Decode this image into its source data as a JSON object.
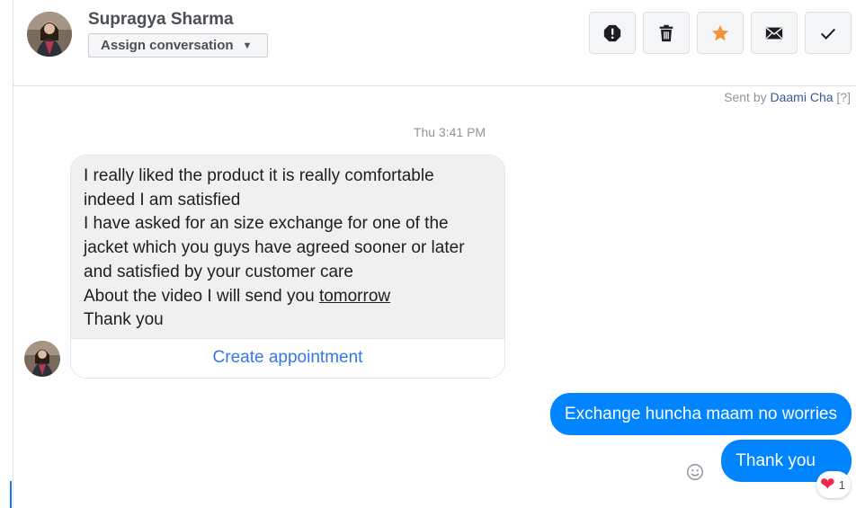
{
  "contact": {
    "name": "Supragya Sharma",
    "assign_label": "Assign conversation"
  },
  "toolbar": {
    "buttons": [
      {
        "icon": "alert-icon",
        "color": "#1c1e21"
      },
      {
        "icon": "trash-icon",
        "color": "#1c1e21"
      },
      {
        "icon": "star-icon",
        "color": "#f7923b"
      },
      {
        "icon": "envelope-icon",
        "color": "#1c1e21"
      },
      {
        "icon": "check-icon",
        "color": "#1c1e21"
      }
    ]
  },
  "sent_by": {
    "prefix": "Sent by",
    "agent": "Daami Cha",
    "help": "[?]"
  },
  "thread": {
    "timestamp": "Thu 3:41 PM",
    "incoming": {
      "lines": [
        "I really liked the product it is really comfortable",
        "indeed I am satisfied",
        "I have asked for an size exchange for one of the",
        "jacket which you guys have agreed sooner or later",
        "and satisfied by your customer care"
      ],
      "video_line_prefix": "About the video I will send you ",
      "video_line_underlined": "tomorrow",
      "last_line": "Thank you",
      "action_label": "Create appointment"
    },
    "outgoing": [
      {
        "text": "Exchange huncha maam no worries"
      },
      {
        "text": "Thank you"
      }
    ],
    "reaction": {
      "emoji": "❤",
      "count": "1"
    }
  },
  "colors": {
    "brand_blue": "#0084ff",
    "link_blue": "#3578e5",
    "agent_blue": "#365899",
    "star_orange": "#f7923b"
  }
}
